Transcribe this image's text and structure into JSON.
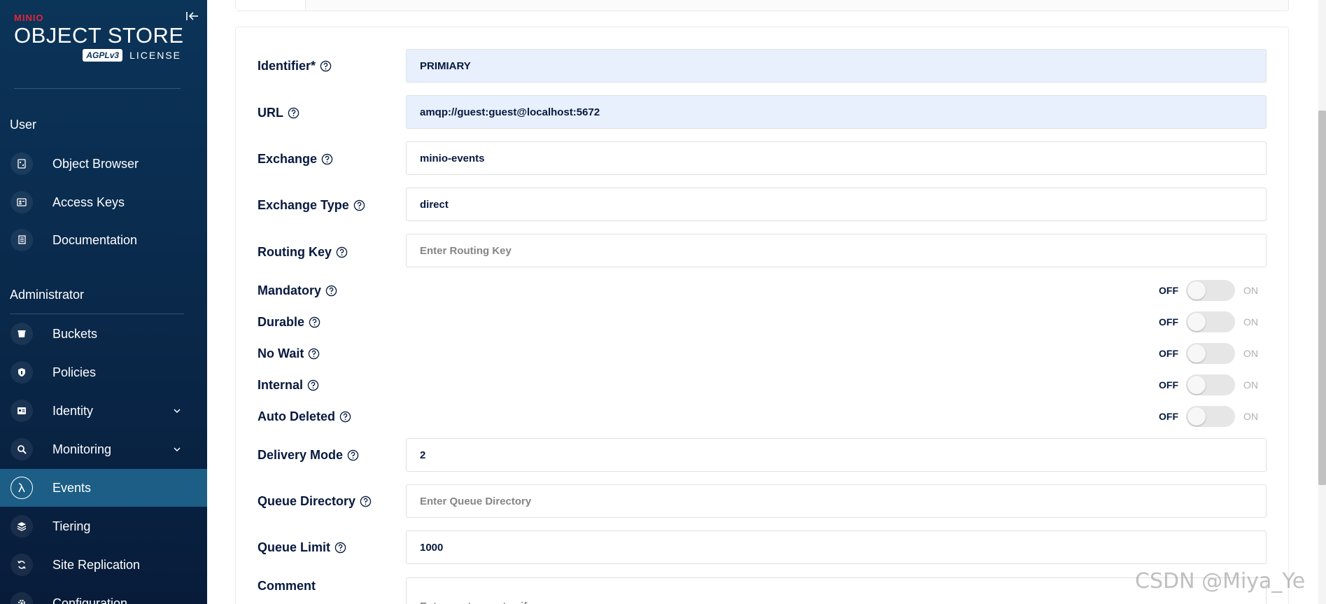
{
  "logo": {
    "brand": "MINIO",
    "product": "OBJECT STORE",
    "license_badge": "AGPLv3",
    "license": "LICENSE"
  },
  "sidebar": {
    "user_section": {
      "title": "User",
      "items": [
        {
          "label": "Object Browser",
          "icon": "object-browser-icon"
        },
        {
          "label": "Access Keys",
          "icon": "access-keys-icon"
        },
        {
          "label": "Documentation",
          "icon": "documentation-icon"
        }
      ]
    },
    "admin_section": {
      "title": "Administrator",
      "items": [
        {
          "label": "Buckets",
          "icon": "buckets-icon"
        },
        {
          "label": "Policies",
          "icon": "policies-icon"
        },
        {
          "label": "Identity",
          "icon": "identity-icon",
          "expandable": true
        },
        {
          "label": "Monitoring",
          "icon": "monitoring-icon",
          "expandable": true
        },
        {
          "label": "Events",
          "icon": "lambda-icon",
          "active": true
        },
        {
          "label": "Tiering",
          "icon": "tiering-icon"
        },
        {
          "label": "Site Replication",
          "icon": "site-replication-icon"
        },
        {
          "label": "Configuration",
          "icon": "configuration-icon"
        }
      ]
    }
  },
  "form": {
    "identifier": {
      "label": "Identifier*",
      "value": "PRIMIARY"
    },
    "url": {
      "label": "URL",
      "value": "amqp://guest:guest@localhost:5672"
    },
    "exchange": {
      "label": "Exchange",
      "value": "minio-events"
    },
    "exchange_type": {
      "label": "Exchange Type",
      "value": "direct"
    },
    "routing_key": {
      "label": "Routing Key",
      "value": "",
      "placeholder": "Enter Routing Key"
    },
    "toggles": [
      {
        "label": "Mandatory",
        "off": "OFF",
        "on": "ON",
        "state": false
      },
      {
        "label": "Durable",
        "off": "OFF",
        "on": "ON",
        "state": false
      },
      {
        "label": "No Wait",
        "off": "OFF",
        "on": "ON",
        "state": false
      },
      {
        "label": "Internal",
        "off": "OFF",
        "on": "ON",
        "state": false
      },
      {
        "label": "Auto Deleted",
        "off": "OFF",
        "on": "ON",
        "state": false
      }
    ],
    "delivery_mode": {
      "label": "Delivery Mode",
      "value": "2"
    },
    "queue_directory": {
      "label": "Queue Directory",
      "value": "",
      "placeholder": "Enter Queue Directory"
    },
    "queue_limit": {
      "label": "Queue Limit",
      "value": "1000"
    },
    "comment": {
      "label": "Comment",
      "value": "",
      "placeholder": "Enter custom notes if any"
    }
  },
  "watermark": "CSDN @Miya_Ye",
  "colors": {
    "sidebar_bg": "#0b3459",
    "active_item": "#1c5e86",
    "autofill_bg": "#e8f0fe",
    "brand_red": "#e0263a",
    "text_dark": "#07193e"
  }
}
